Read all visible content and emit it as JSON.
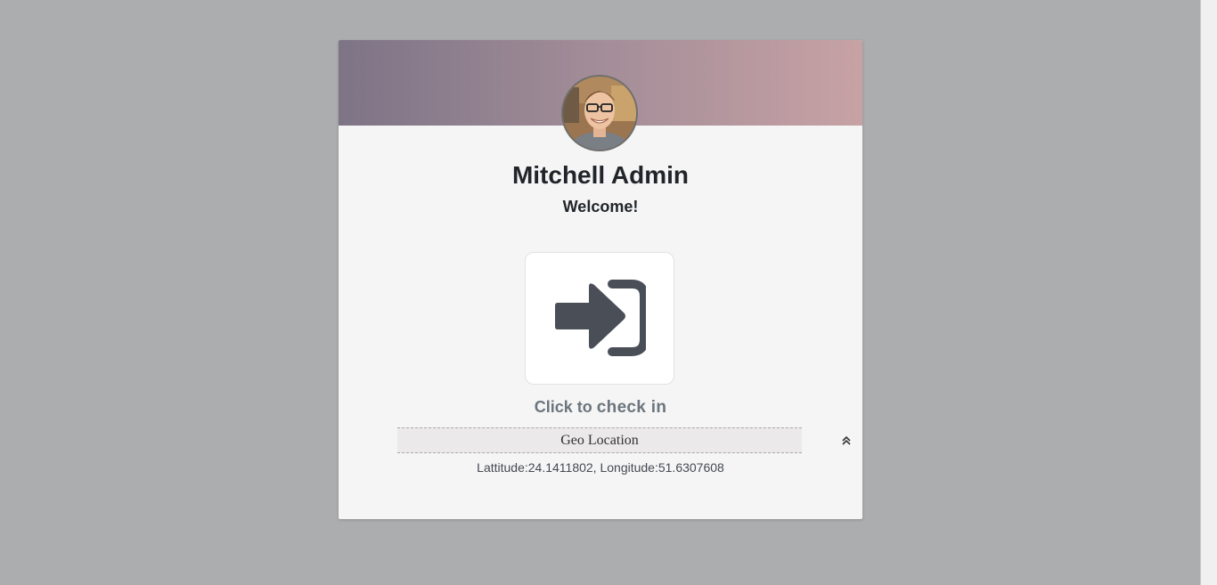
{
  "user": {
    "name": "Mitchell Admin",
    "greeting": "Welcome!",
    "avatar_icon": "user-avatar-photo"
  },
  "attendance": {
    "button_icon": "sign-in-icon",
    "caption_prefix": "Click to",
    "caption_action": "check in"
  },
  "geo": {
    "header_label": "Geo Location",
    "toggle_icon": "double-chevron-up-icon",
    "coordinates_text": "Lattitude:24.1411802, Longitude:51.6307608"
  },
  "colors": {
    "page_background": "#acadaf",
    "card_background": "#f5f5f5",
    "header_gradient_start": "#7d7486",
    "header_gradient_end": "#c7a2a5",
    "icon_color": "#4a4f57"
  }
}
